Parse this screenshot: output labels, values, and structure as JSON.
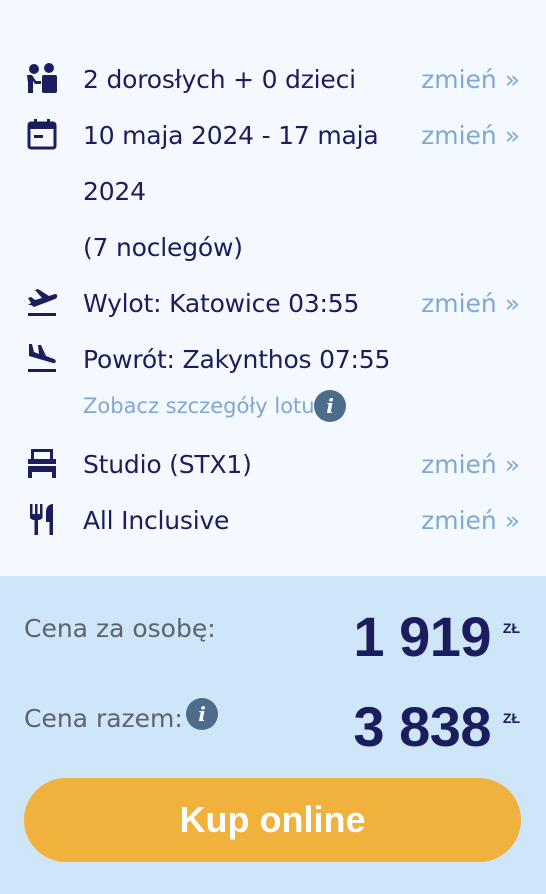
{
  "rows": {
    "guests": {
      "text": "2 dorosłych + 0 dzieci",
      "change": "zmień »"
    },
    "dates": {
      "line1": "10 maja 2024 - 17 maja",
      "line2": "2024",
      "line3": "(7 noclegów)",
      "change": "zmień »"
    },
    "departure": {
      "text": "Wylot: Katowice 03:55",
      "change": "zmień »"
    },
    "return": {
      "text": "Powrót: Zakynthos 07:55"
    },
    "flight_details_link": "Zobacz szczegóły lotu",
    "room": {
      "text": "Studio (STX1)",
      "change": "zmień »"
    },
    "board": {
      "text": "All Inclusive",
      "change": "zmień »"
    }
  },
  "icons": {
    "guests": "family-icon",
    "dates": "calendar-icon",
    "departure": "plane-takeoff-icon",
    "return": "plane-landing-icon",
    "room": "bed-icon",
    "board": "fork-knife-icon",
    "info": "info-icon"
  },
  "info_glyph": "i",
  "price": {
    "per_person_label": "Cena za osobę:",
    "per_person_value": "1 919",
    "total_label": "Cena razem:",
    "total_value": "3 838",
    "currency": "ZŁ"
  },
  "buy_button": "Kup online",
  "colors": {
    "text": "#1b1d5c",
    "link": "#7fa9d3",
    "top_bg": "#f3f9fe",
    "price_bg": "#cfe6f8",
    "button": "#f0b13d",
    "info_dot": "#4d6c8c"
  }
}
